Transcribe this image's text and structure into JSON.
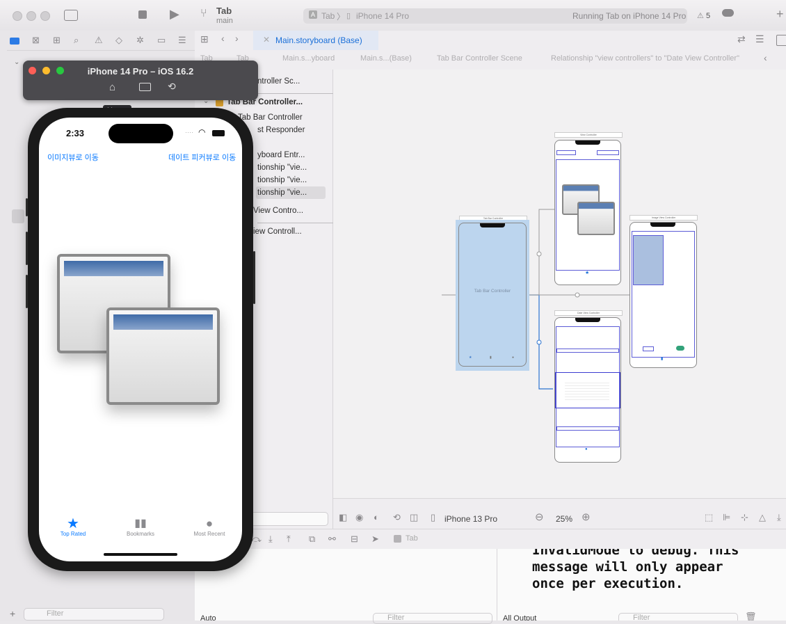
{
  "toolbar": {
    "project_name": "Tab",
    "branch": "main",
    "scheme": "Tab",
    "device": "iPhone 14 Pro",
    "status": "Running Tab on iPhone 14 Pro",
    "warning_count": "5"
  },
  "editor_tab": {
    "label": "Main.storyboard (Base)"
  },
  "jumpbar": {
    "crumbs": [
      "Tab",
      "Tab",
      "Main.s...yboard",
      "Main.s...(Base)",
      "Tab Bar Controller Scene",
      "Relationship \"view controllers\" to \"Date View Controller\""
    ]
  },
  "outline": {
    "rows": [
      "ntroller Sc...",
      "Tab Bar Controller...",
      "Tab Bar Controller",
      "st Responder",
      "yboard Entr...",
      "tionship \"vie...",
      "tionship \"vie...",
      "tionship \"vie...",
      "View Contro...",
      "iew Controll..."
    ]
  },
  "simulator": {
    "title": "iPhone 14 Pro – iOS 16.2",
    "tooltip": "Home",
    "time": "2:33",
    "left_link": "이미지뷰로 이동",
    "right_link": "데이트 피커뷰로 이동",
    "tabs": [
      {
        "label": "Top Rated",
        "icon": "star-icon",
        "selected": true
      },
      {
        "label": "Bookmarks",
        "icon": "book-icon",
        "selected": false
      },
      {
        "label": "Most Recent",
        "icon": "clock-icon",
        "selected": false
      }
    ]
  },
  "canvas": {
    "tab_bar_controller_label": "Tab Bar Controller",
    "scene_titles": [
      "Tab Bar Controller",
      "View Controller",
      "Image View Controller",
      "Date View Controller"
    ],
    "tab_labels": [
      "Top Rated",
      "Bookmarks",
      "Most Recent"
    ]
  },
  "canvas_bottom": {
    "device": "iPhone 13 Pro",
    "zoom": "25%"
  },
  "debugbar": {
    "target": "Tab"
  },
  "variables": {
    "mode": "Auto",
    "filter_placeholder": "Filter"
  },
  "console": {
    "output": "InvalidMode to debug. This\nmessage will only appear\nonce per execution.",
    "output_selector": "All Output",
    "filter_placeholder": "Filter"
  },
  "navigator": {
    "filter_placeholder": "Filter"
  }
}
